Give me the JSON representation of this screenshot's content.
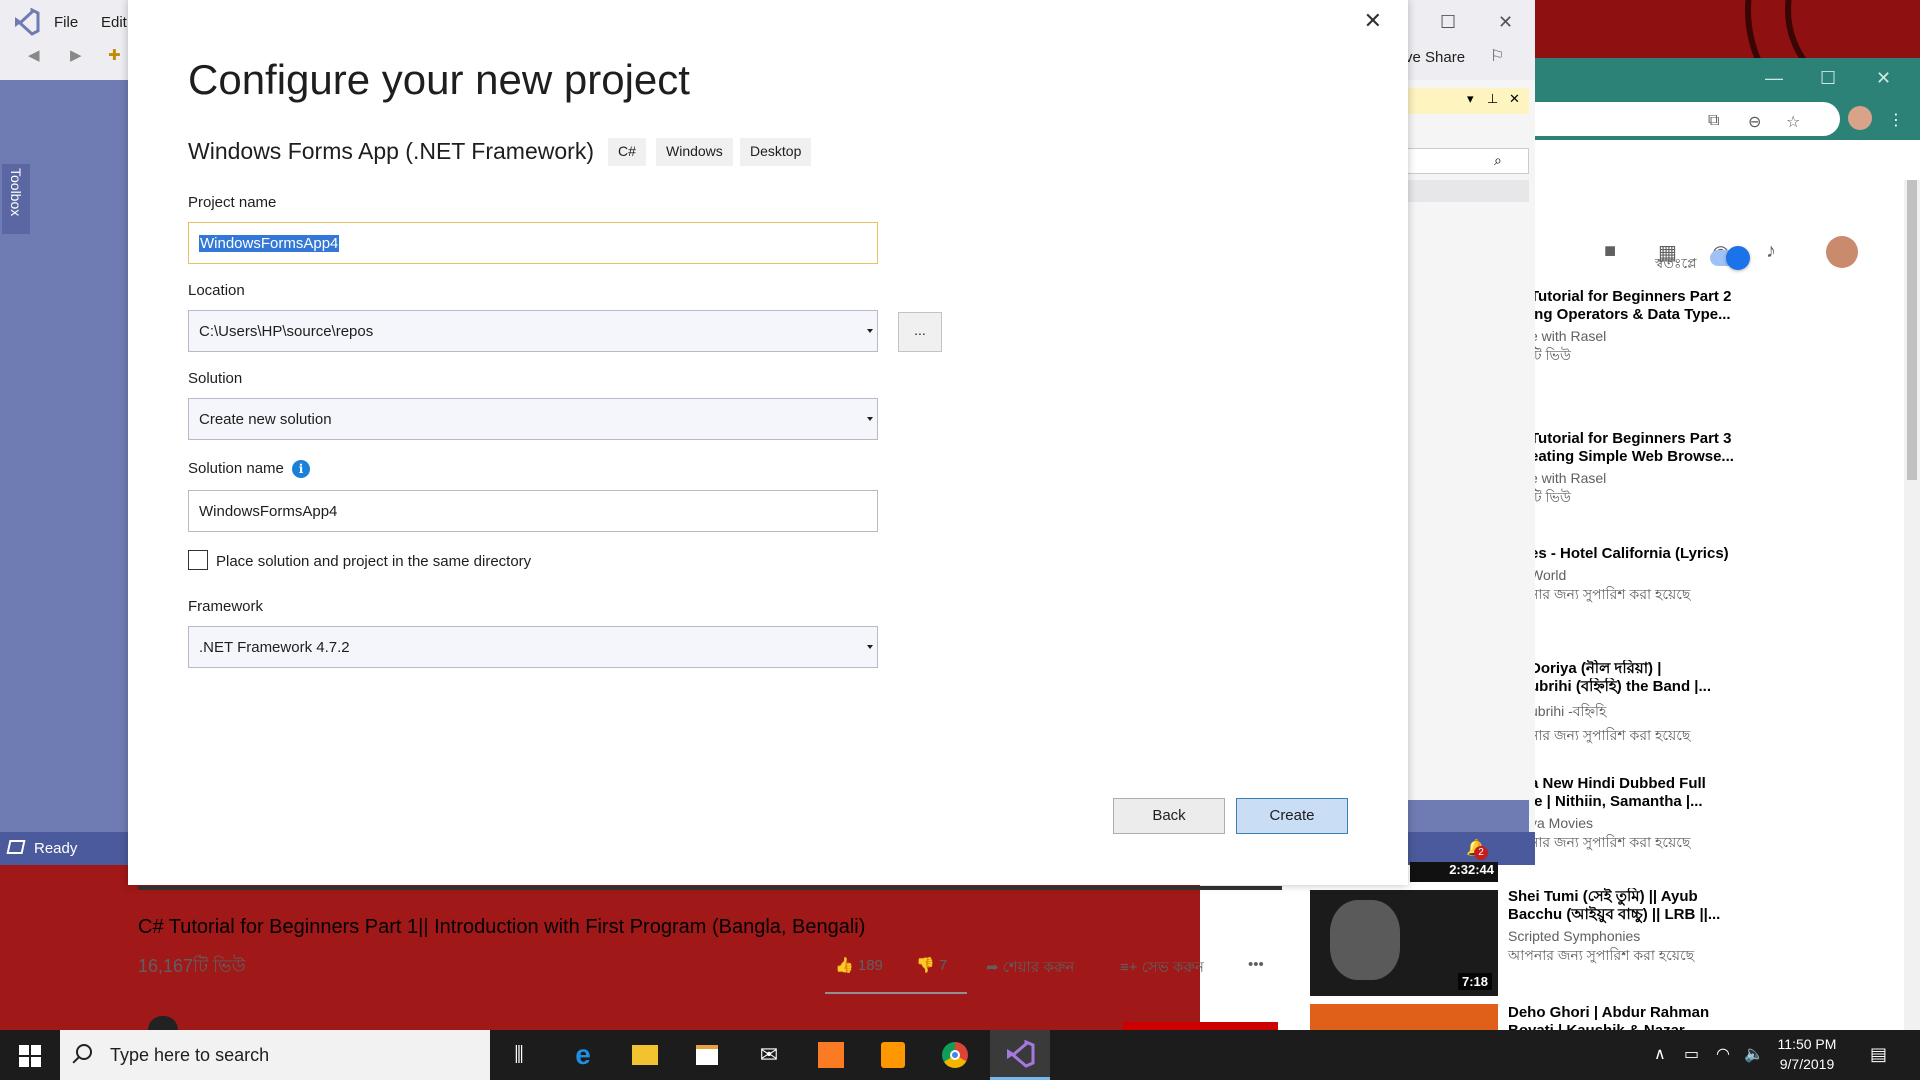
{
  "vs": {
    "menu": [
      "File",
      "Edit"
    ],
    "toolbox_label": "Toolbox",
    "status": "Ready",
    "share_label": "ve Share",
    "notification_count": "2"
  },
  "dialog": {
    "title": "Configure your new project",
    "template_name": "Windows Forms App (.NET Framework)",
    "tags": [
      "C#",
      "Windows",
      "Desktop"
    ],
    "project_name_label": "Project name",
    "project_name_value": "WindowsFormsApp4",
    "location_label": "Location",
    "location_value": "C:\\Users\\HP\\source\\repos",
    "browse_label": "...",
    "solution_label": "Solution",
    "solution_value": "Create new solution",
    "solution_name_label": "Solution name",
    "solution_name_value": "WindowsFormsApp4",
    "same_dir_label": "Place solution and project in the same directory",
    "same_dir_checked": false,
    "framework_label": "Framework",
    "framework_value": ".NET Framework 4.7.2",
    "back_label": "Back",
    "create_label": "Create"
  },
  "youtube": {
    "autoplay_label": "স্বতঃপ্লে",
    "video_title": "C# Tutorial for Beginners Part 1|| Introduction with First Program (Bangla, Bengali)",
    "video_views": "16,167টি ভিউ",
    "likes": "189",
    "dislikes": "7",
    "share_label": "শেয়ার করুন",
    "save_label": "সেভ করুন",
    "sidebar": [
      {
        "title1": "Tutorial for Beginners Part 2",
        "title2": "ing Operators & Data Type...",
        "channel": "e with Rasel",
        "meta": "টি ভিউ"
      },
      {
        "title1": "Tutorial for Beginners Part 3",
        "title2": "eating Simple Web Browse...",
        "channel": "e with Rasel",
        "meta": "টি ভিউ"
      },
      {
        "title1": "es - Hotel California (Lyrics)",
        "title2": "",
        "channel": "World",
        "meta": "নার জন্য সুপারিশ করা হয়েছে"
      },
      {
        "title1": "Doriya (নীল দরিয়া) |",
        "title2": "ubrihi (বহ্নিহি) the Band |...",
        "channel": "ubrihi -বহ্নিহি",
        "meta": "নার জন্য সুপারিশ করা হয়েছে"
      },
      {
        "title1": "a New Hindi Dubbed Full",
        "title2": "ie | Nithiin, Samantha |...",
        "channel": "ya Movies",
        "meta": "নার জন্য সুপারিশ করা হয়েছে"
      }
    ],
    "sidebar_full": [
      {
        "title1": "Shei Tumi (সেই তুমি) || Ayub",
        "title2": "Bacchu (আইয়ুব বাচ্চু) || LRB ||...",
        "channel": "Scripted Symphonies",
        "meta": "আপনার জন্য সুপারিশ করা হয়েছে",
        "duration": "7:18"
      },
      {
        "title1": "Deho Ghori | Abdur Rahman",
        "title2": "Boyati | Kaushik & Nazar",
        "channel": "",
        "meta": "",
        "duration": ""
      }
    ],
    "thumb_duration_top": "2:32:44"
  },
  "taskbar": {
    "search_placeholder": "Type here to search",
    "time": "11:50 PM",
    "date": "9/7/2019"
  },
  "colors": {
    "vs_accent": "#6f7bb3",
    "vs_status": "#4b5a9c",
    "create_button": "#c9def5",
    "browser_header": "#2c8276",
    "youtube_toggle": "#1a73e8"
  }
}
